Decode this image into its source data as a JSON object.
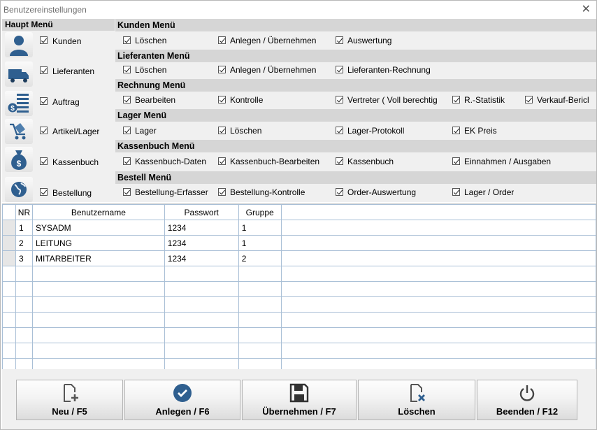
{
  "window": {
    "title": "Benutzereinstellungen",
    "close_glyph": "✕"
  },
  "haupt_menu": {
    "title": "Haupt Menü",
    "items": [
      {
        "label": "Kunden",
        "icon": "person-icon",
        "checked": true
      },
      {
        "label": "Lieferanten",
        "icon": "truck-icon",
        "checked": true
      },
      {
        "label": "Auftrag",
        "icon": "invoice-icon",
        "checked": true
      },
      {
        "label": "Artikel/Lager",
        "icon": "cart-icon",
        "checked": true
      },
      {
        "label": "Kassenbuch",
        "icon": "money-bag-icon",
        "checked": true
      },
      {
        "label": "Bestellung",
        "icon": "globe-icon",
        "checked": true
      }
    ]
  },
  "sections": [
    {
      "title": "Kunden Menü",
      "items": [
        "Löschen",
        "Anlegen / Übernehmen",
        "Auswertung"
      ]
    },
    {
      "title": "Lieferanten Menü",
      "items": [
        "Löschen",
        "Anlegen / Übernehmen",
        "Lieferanten-Rechnung"
      ]
    },
    {
      "title": "Rechnung Menü",
      "items": [
        "Bearbeiten",
        "Kontrolle",
        "Vertreter ( Voll berechtig",
        "R.-Statistik",
        "Verkauf-Bericl"
      ]
    },
    {
      "title": "Lager Menü",
      "items": [
        "Lager",
        "Löschen",
        "Lager-Protokoll",
        "EK Preis"
      ]
    },
    {
      "title": "Kassenbuch Menü",
      "items": [
        "Kassenbuch-Daten",
        "Kassenbuch-Bearbeiten",
        "Kassenbuch",
        "Einnahmen / Ausgaben"
      ]
    },
    {
      "title": "Bestell Menü",
      "items": [
        "Bestellung-Erfasser",
        "Bestellung-Kontrolle",
        "Order-Auswertung",
        "Lager / Order"
      ]
    }
  ],
  "table": {
    "columns": [
      "NR",
      "Benutzername",
      "Passwort",
      "Gruppe"
    ],
    "rows": [
      [
        "1",
        "SYSADM",
        "1234",
        "1"
      ],
      [
        "2",
        "LEITUNG",
        "1234",
        "1"
      ],
      [
        "3",
        "MITARBEITER",
        "1234",
        "2"
      ]
    ]
  },
  "buttons": [
    {
      "label": "Neu / F5",
      "icon": "new-file-icon"
    },
    {
      "label": "Anlegen / F6",
      "icon": "checkmark-circle-icon"
    },
    {
      "label": "Übernehmen / F7",
      "icon": "save-floppy-icon"
    },
    {
      "label": "Löschen",
      "icon": "delete-file-icon"
    },
    {
      "label": "Beenden / F12",
      "icon": "power-icon"
    }
  ],
  "colors": {
    "section_header": "#d6d6d6",
    "panel": "#f0f0f0",
    "grid_line": "#a9bfd6",
    "icon_blue": "#2f5f8f"
  }
}
